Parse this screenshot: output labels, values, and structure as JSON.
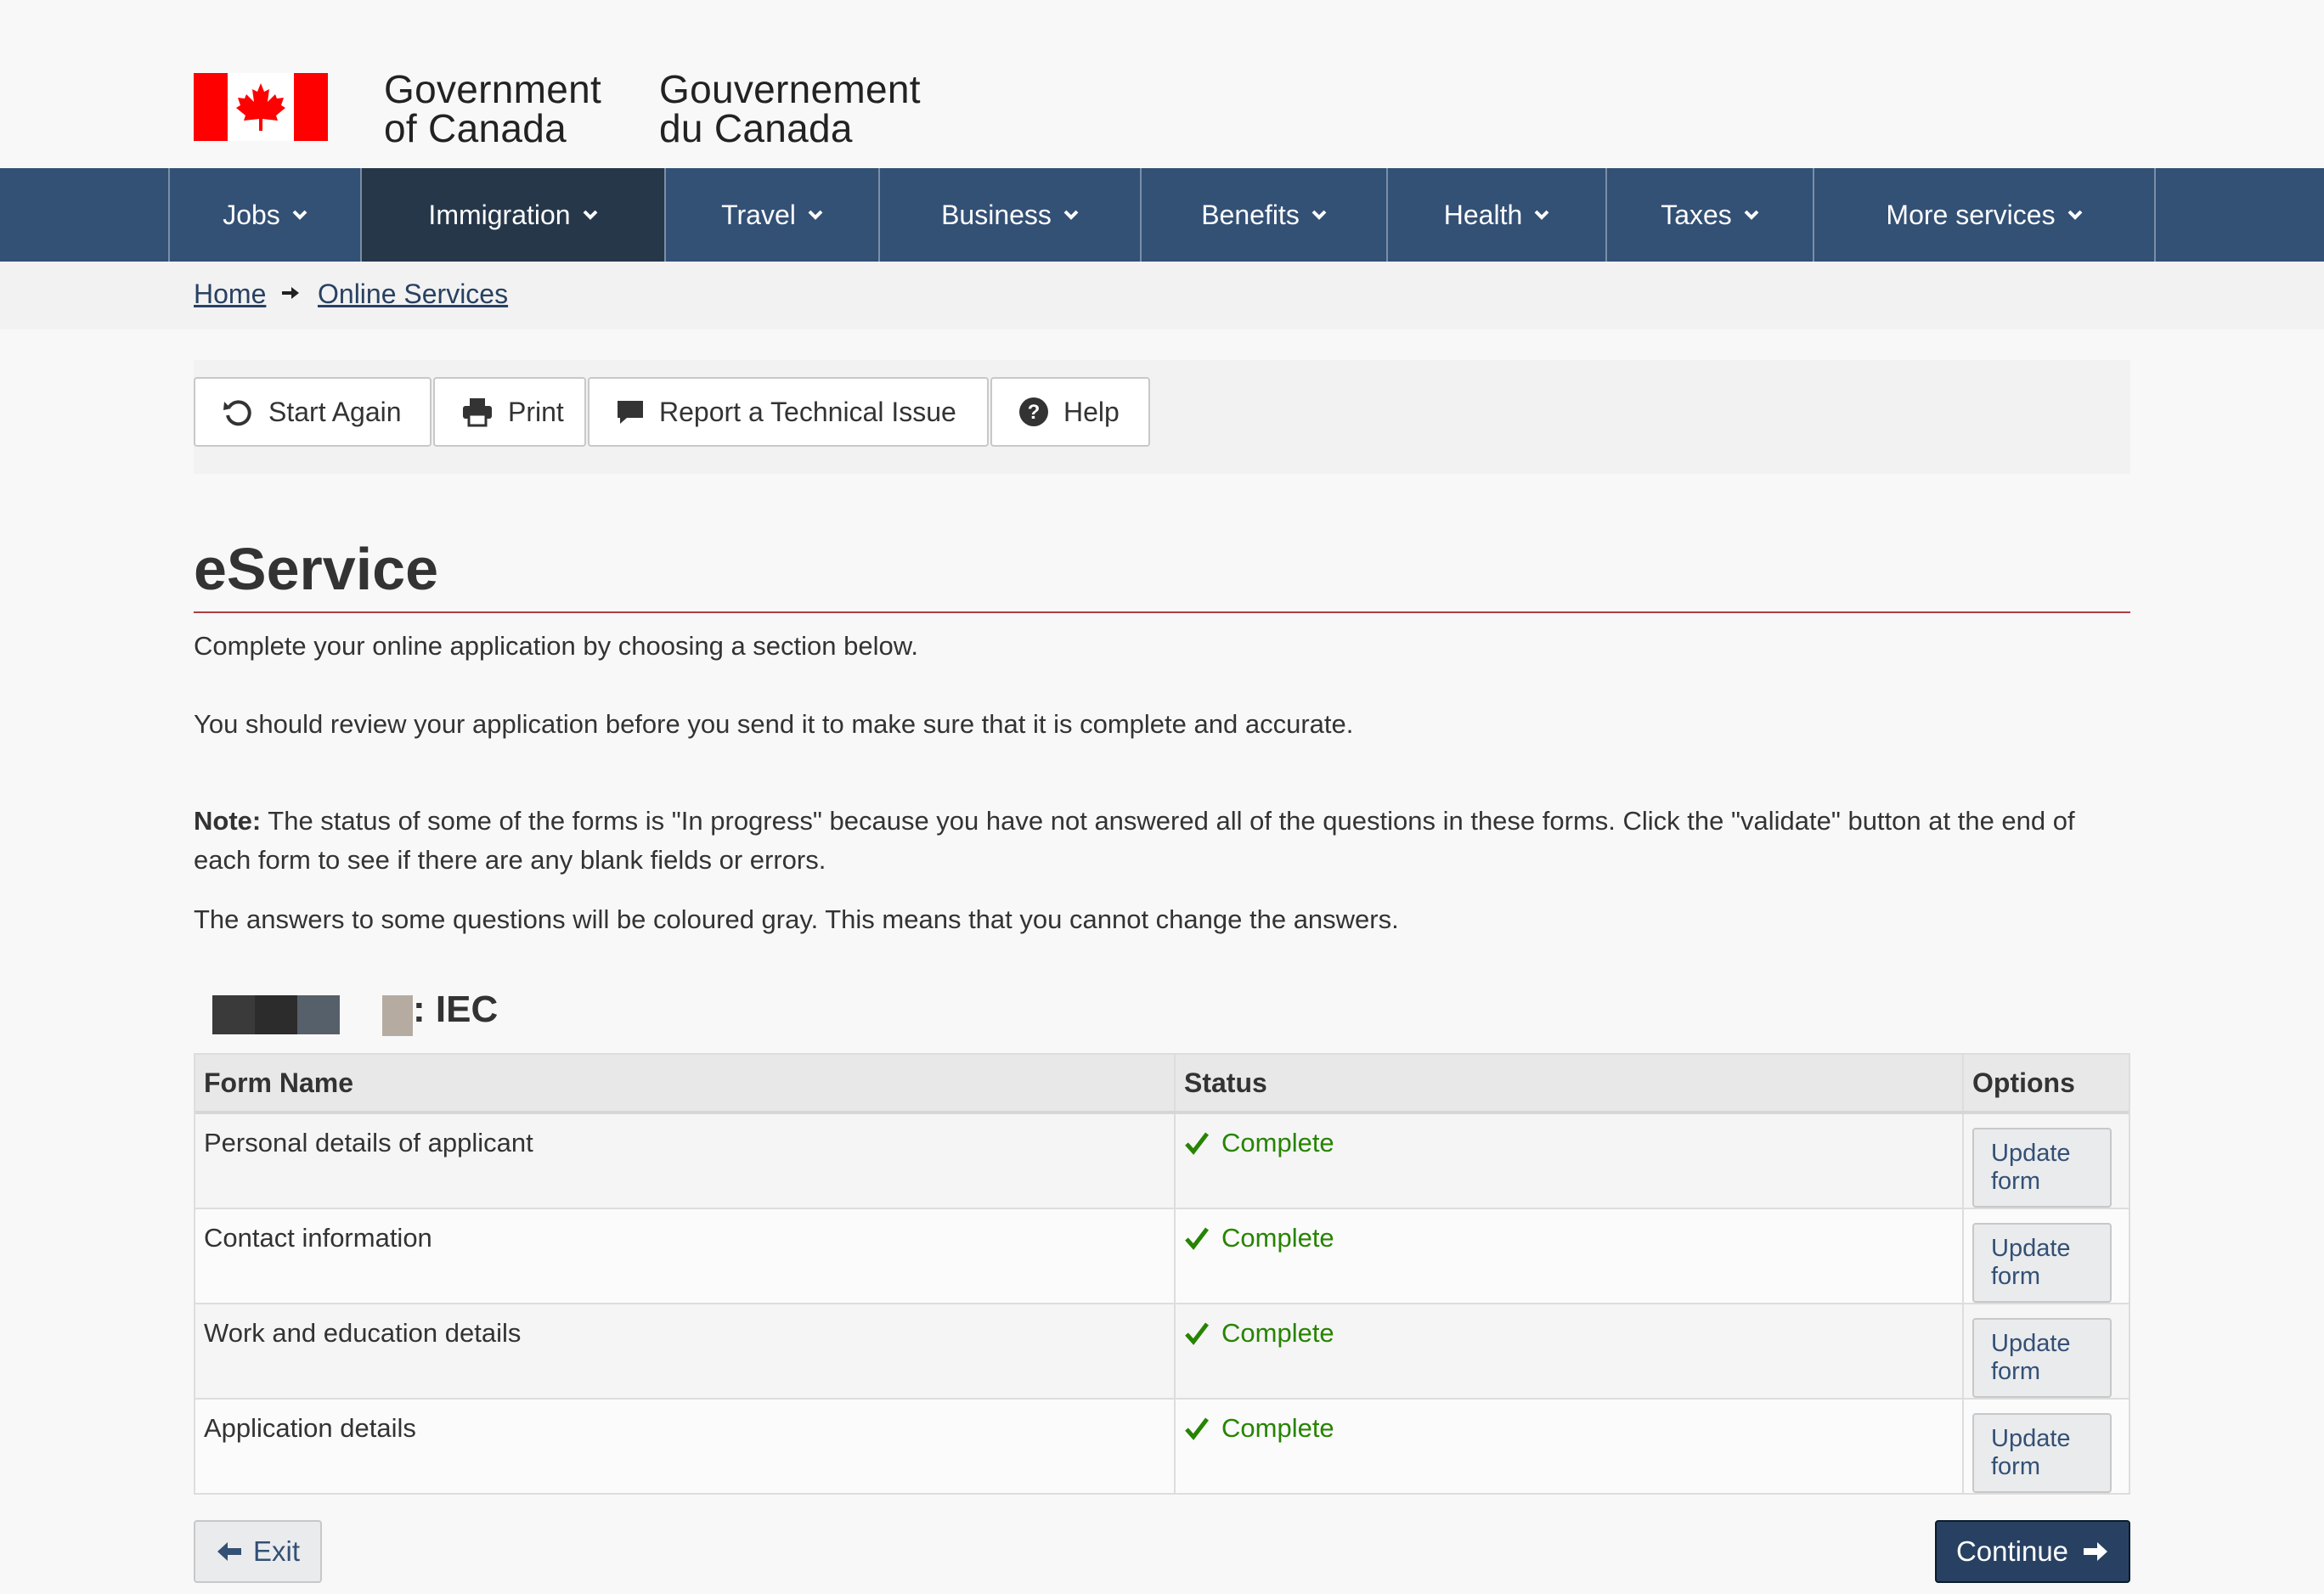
{
  "header": {
    "signature_en": [
      "Government",
      "of Canada"
    ],
    "signature_fr": [
      "Gouvernement",
      "du Canada"
    ],
    "flag_color": "#FF0000"
  },
  "nav": {
    "items": [
      {
        "label": "Jobs",
        "active": false
      },
      {
        "label": "Immigration",
        "active": true
      },
      {
        "label": "Travel",
        "active": false
      },
      {
        "label": "Business",
        "active": false
      },
      {
        "label": "Benefits",
        "active": false
      },
      {
        "label": "Health",
        "active": false
      },
      {
        "label": "Taxes",
        "active": false
      },
      {
        "label": "More services",
        "active": false
      }
    ],
    "background": "#335075",
    "active_background": "#26374a"
  },
  "breadcrumb": {
    "home": "Home",
    "online_services": "Online Services"
  },
  "toolbar": {
    "start_again": "Start Again",
    "print": "Print",
    "report": "Report a Technical Issue",
    "help": "Help"
  },
  "main": {
    "title": "eService",
    "intro": "Complete your online application by choosing a section below.",
    "review": "You should review your application before you send it to make sure that it is complete and accurate.",
    "note_label": "Note:",
    "note_text": " The status of some of the forms is \"In progress\" because you have not answered all of the questions in these forms. Click the \"validate\" button at the end of each form to see if there are any blank fields or errors.",
    "gray_text": "The answers to some questions will be coloured gray. This means that you cannot change the answers.",
    "subtitle": ": IEC"
  },
  "table": {
    "headers": [
      "Form Name",
      "Status",
      "Options"
    ],
    "rows": [
      {
        "name": "Personal details of applicant",
        "status": "Complete",
        "option": "Update form"
      },
      {
        "name": "Contact information",
        "status": "Complete",
        "option": "Update form"
      },
      {
        "name": "Work and education details",
        "status": "Complete",
        "option": "Update form"
      },
      {
        "name": "Application details",
        "status": "Complete",
        "option": "Update form"
      }
    ],
    "status_color": "#278400"
  },
  "footer_buttons": {
    "exit": "Exit",
    "continue": "Continue"
  }
}
